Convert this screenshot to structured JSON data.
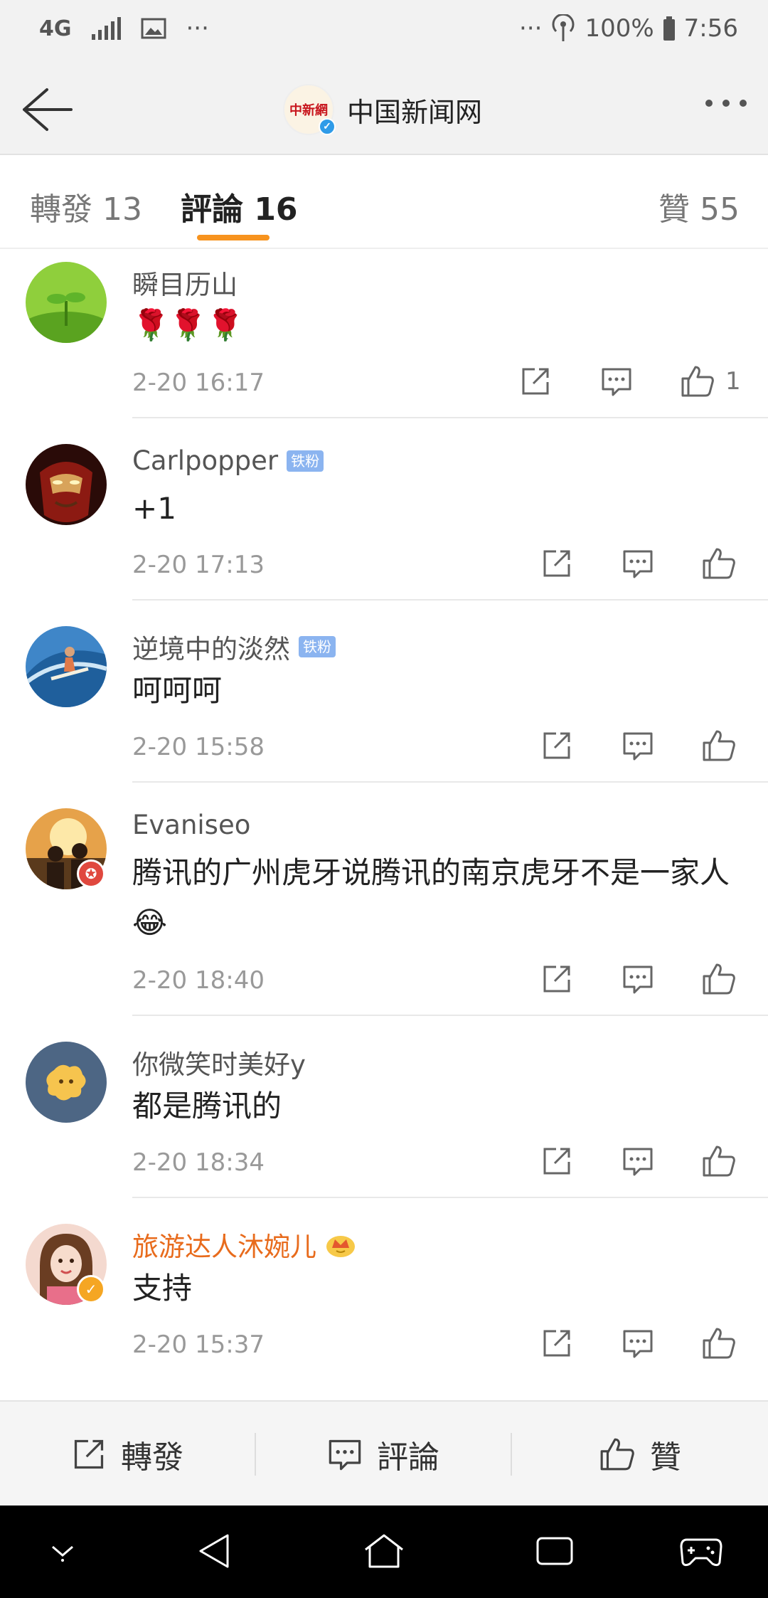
{
  "status_bar": {
    "network": "4G",
    "battery": "100%",
    "time": "7:56"
  },
  "header": {
    "title": "中国新闻网",
    "logo_text": "中新網"
  },
  "tabs": [
    {
      "label": "轉發 13"
    },
    {
      "label": "評論 16",
      "active": true
    },
    {
      "label": "贊 55"
    }
  ],
  "comments": [
    {
      "author": "瞬目历山",
      "badge": "",
      "content": "🌹🌹🌹",
      "time": "2-20 16:17",
      "likes": "1"
    },
    {
      "author": "Carlpopper",
      "badge": "铁粉",
      "content": "+1",
      "time": "2-20 17:13",
      "likes": ""
    },
    {
      "author": "逆境中的淡然",
      "badge": "铁粉",
      "content": "呵呵呵",
      "time": "2-20 15:58",
      "likes": ""
    },
    {
      "author": "Evaniseo",
      "badge": "",
      "content": "腾讯的广州虎牙说腾讯的南京虎牙不是一家人😂",
      "time": "2-20 18:40",
      "likes": ""
    },
    {
      "author": "你微笑时美好y",
      "badge": "",
      "content": "都是腾讯的",
      "time": "2-20 18:34",
      "likes": ""
    },
    {
      "author": "旅游达人沐婉儿",
      "badge": "",
      "content": "支持",
      "time": "2-20 15:37",
      "likes": ""
    }
  ],
  "bottom_bar": {
    "repost": "轉發",
    "comment": "評論",
    "like": "贊"
  },
  "colors": {
    "accent": "#f7931e",
    "vip_name": "#e86b1c",
    "badge": "#8bb4f0",
    "verified": "#2f9be8"
  }
}
